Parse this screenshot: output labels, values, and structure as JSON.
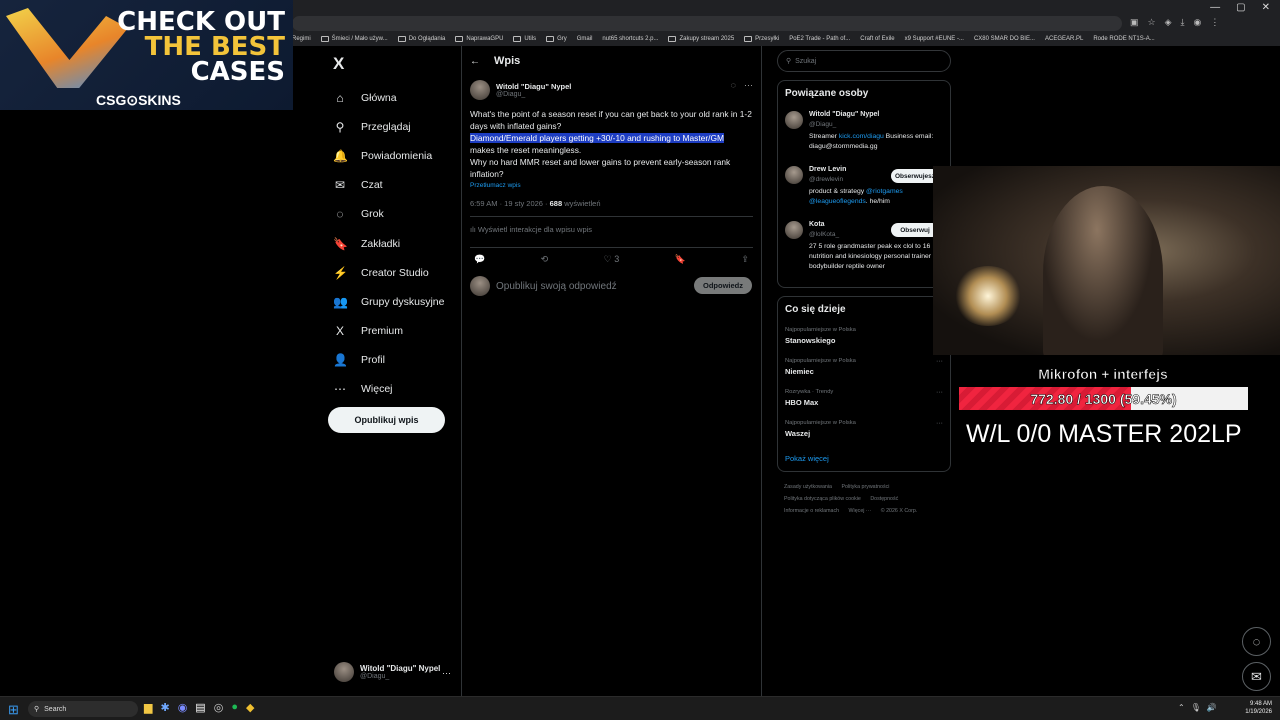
{
  "browser": {
    "window_controls": [
      "—",
      "▢",
      "✕"
    ],
    "bookmarks": [
      "Regimi",
      "Śmieci / Mało używ...",
      "Do Oglądania",
      "NaprawaGPU",
      "Utils",
      "Gry",
      "Gmail",
      "nut65 shortcuts 2.p...",
      "Zakupy stream 2025",
      "Przesyłki",
      "PoE2 Trade - Path of...",
      "Craft of Exile",
      "x9 Support #EUNE -...",
      "CX80 SMAR DO BIE...",
      "ACEGEAR.PL",
      "Rode RODE NT1S-A..."
    ]
  },
  "ad": {
    "line1": "CHECK OUT",
    "line2": "THE BEST",
    "line3": "CASES",
    "brand": "CSG⊙SKINS"
  },
  "nav": {
    "logo": "X",
    "items": [
      {
        "label": "Główna",
        "icon": "⌂"
      },
      {
        "label": "Przeglądaj",
        "icon": "⚲"
      },
      {
        "label": "Powiadomienia",
        "icon": "🔔"
      },
      {
        "label": "Czat",
        "icon": "✉"
      },
      {
        "label": "Grok",
        "icon": "◌"
      },
      {
        "label": "Zakładki",
        "icon": "🔖"
      },
      {
        "label": "Creator Studio",
        "icon": "⚡"
      },
      {
        "label": "Grupy dyskusyjne",
        "icon": "👥"
      },
      {
        "label": "Premium",
        "icon": "X"
      },
      {
        "label": "Profil",
        "icon": "👤"
      },
      {
        "label": "Więcej",
        "icon": "⋯"
      }
    ],
    "post_button": "Opublikuj wpis",
    "account": {
      "name": "Witold \"Diagu\" Nypel",
      "handle": "@Diagu_",
      "more": "···"
    }
  },
  "post": {
    "back": "←",
    "header_title": "Wpis",
    "author_name": "Witold \"Diagu\" Nypel",
    "author_handle": "@Diagu_",
    "text_1": "What's the point of a season reset if you can get back to your old rank in 1-2 days with inflated gains?",
    "text_highlight": "Diamond/Emerald players getting +30/-10 and rushing to Master/GM",
    "text_2": "makes the reset meaningless.",
    "text_3": "Why no hard MMR reset and lower gains to prevent early-season rank inflation?",
    "translate": "Przetłumacz wpis",
    "time": "6:59 AM · 19 sty 2026 ·",
    "views_count": "688",
    "views_label": "wyświetleń",
    "interactions": "Wyświetl interakcje dla wpisu wpis",
    "actions": {
      "reply": "💬",
      "repost": "⟲",
      "like": "♡",
      "like_count": "3",
      "bookmark": "🔖",
      "share": "⇪"
    },
    "reply_placeholder": "Opublikuj swoją odpowiedź",
    "reply_button": "Odpowiedz"
  },
  "sidebar": {
    "search_placeholder": "Szukaj",
    "related_title": "Powiązane osoby",
    "people": [
      {
        "name": "Witold \"Diagu\" Nypel",
        "handle": "@Diagu_",
        "bio_pre": "Streamer ",
        "bio_link": "kick.com/diagu",
        "bio_post": " Business email: diagu@stormmedia.gg"
      },
      {
        "name": "Drew Levin",
        "handle": "@drewlevin",
        "bio_pre": "product & strategy ",
        "bio_link": "@riotgames @leagueoflegends",
        "bio_post": ". he/him",
        "follow": "Obserwujesz"
      },
      {
        "name": "Kota",
        "handle": "@lolKota_",
        "bio_pre": "27 5 role grandmaster peak ex clol to 16 nutrition and kinesiology personal trainer and bodybuilder reptile owner",
        "bio_link": "",
        "bio_post": "",
        "follow": "Obserwuj"
      }
    ],
    "trends_title": "Co się dzieje",
    "trends": [
      {
        "context": "Najpopularniejsze w Polska",
        "name": "Stanowskiego"
      },
      {
        "context": "Najpopularniejsze w Polska",
        "name": "Niemiec"
      },
      {
        "context": "Rozrywka · Trendy",
        "name": "HBO Max"
      },
      {
        "context": "Najpopularniejsze w Polska",
        "name": "Waszej"
      }
    ],
    "show_more": "Pokaż więcej",
    "footer": [
      "Zasady użytkowania",
      "Polityka prywatności",
      "Polityka dotycząca plików cookie",
      "Dostępność",
      "Informacje o reklamach",
      "Więcej ···",
      "© 2026 X Corp."
    ]
  },
  "overlay": {
    "title": "Mikrofon + interfejs",
    "progress_text": "772.80 / 1300 (59.45%)",
    "progress_fraction": 0.5945,
    "record": "W/L 0/0 MASTER 202LP"
  },
  "taskbar": {
    "search": "Search",
    "time": "9:48 AM",
    "date": "1/19/2026"
  }
}
